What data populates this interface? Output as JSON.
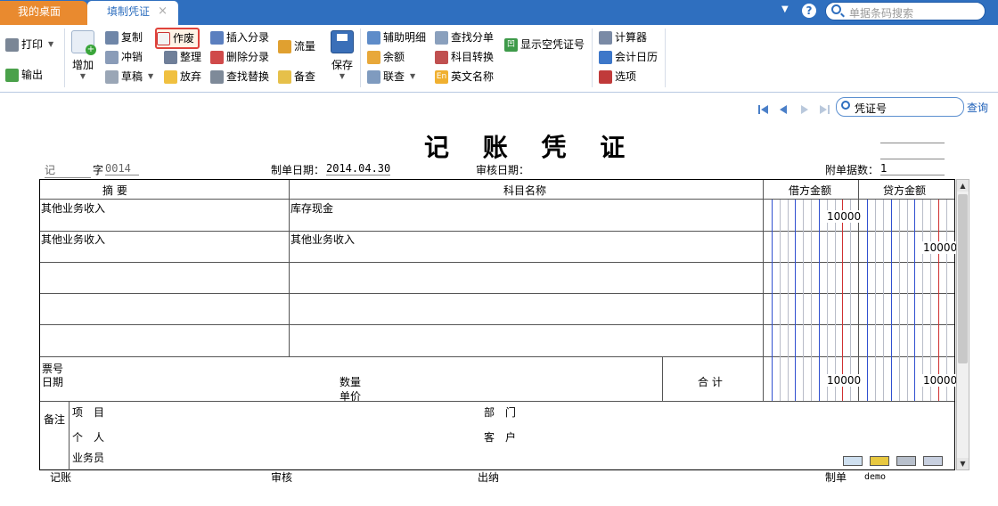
{
  "tabs": {
    "home": "我的桌面",
    "active": "填制凭证",
    "close_glyph": "×"
  },
  "topbar": {
    "search_placeholder": "单据条码搜索",
    "help_glyph": "?",
    "dropdown_glyph": "▼"
  },
  "toolbar": {
    "print": "打印",
    "export": "输出",
    "add": "增加",
    "copy": "复制",
    "reverse": "冲销",
    "draft": "草稿",
    "void": "作废",
    "organize": "整理",
    "abandon": "放弃",
    "insert_entry": "插入分录",
    "delete_entry": "删除分录",
    "find_replace": "查找替换",
    "flow": "流量",
    "check": "备查",
    "save": "保存",
    "aux_detail": "辅助明细",
    "balance": "余额",
    "link_query": "联查",
    "find_entry": "查找分单",
    "account_convert": "科目转换",
    "english_name": "英文名称",
    "show_empty_no": "显示空凭证号",
    "calculator": "计算器",
    "calendar": "会计日历",
    "options": "选项",
    "english_icon_text": "En",
    "show_empty_icon_text": "凹"
  },
  "nav": {
    "search_placeholder": "凭证号",
    "query": "查询"
  },
  "voucher": {
    "title": "记 账 凭 证",
    "type": "记",
    "zi": "字",
    "number": "0014",
    "date_label": "制单日期：",
    "date": "2014.04.30",
    "audit_date_label": "审核日期：",
    "attachments_label": "附单据数：",
    "attachments": "1",
    "col_summary": "摘 要",
    "col_account": "科目名称",
    "col_debit": "借方金额",
    "col_credit": "贷方金额",
    "rows": [
      {
        "summary": "其他业务收入",
        "account": "库存现金",
        "debit": "10000",
        "credit": ""
      },
      {
        "summary": "其他业务收入",
        "account": "其他业务收入",
        "debit": "",
        "credit": "10000"
      },
      {
        "summary": "",
        "account": "",
        "debit": "",
        "credit": ""
      },
      {
        "summary": "",
        "account": "",
        "debit": "",
        "credit": ""
      },
      {
        "summary": "",
        "account": "",
        "debit": "",
        "credit": ""
      }
    ],
    "ticket_no": "票号",
    "ticket_date": "日期",
    "quantity": "数量",
    "unit_price": "单价",
    "total_label": "合 计",
    "total_debit": "10000",
    "total_credit": "10000",
    "remarks": "备注",
    "project": "项　目",
    "department": "部　门",
    "person": "个　人",
    "customer": "客　户",
    "salesman": "业务员"
  },
  "footer": {
    "bookkeeper": "记账",
    "auditor": "审核",
    "cashier": "出纳",
    "maker_label": "制单",
    "maker": "demo"
  },
  "colors": {
    "tab_bar": "#2f6fbf",
    "home_tab": "#e98a2f",
    "active_border": "#e0433b",
    "blue_line": "#3050d0",
    "red_line": "#d03030"
  }
}
